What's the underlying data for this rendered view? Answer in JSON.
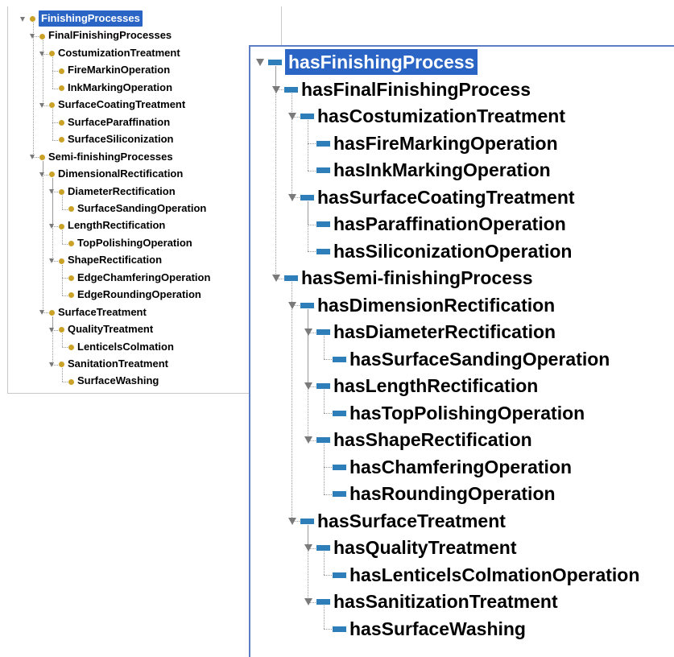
{
  "class_tree": {
    "items": [
      {
        "label": "FinishingProcesses",
        "depth": 0,
        "expanded": true,
        "selected": true
      },
      {
        "label": "FinalFinishingProcesses",
        "depth": 1,
        "expanded": true
      },
      {
        "label": "CostumizationTreatment",
        "depth": 2,
        "expanded": true
      },
      {
        "label": "FireMarkinOperation",
        "depth": 3
      },
      {
        "label": "InkMarkingOperation",
        "depth": 3
      },
      {
        "label": "SurfaceCoatingTreatment",
        "depth": 2,
        "expanded": true
      },
      {
        "label": "SurfaceParaffination",
        "depth": 3
      },
      {
        "label": "SurfaceSiliconization",
        "depth": 3
      },
      {
        "label": "Semi-finishingProcesses",
        "depth": 1,
        "expanded": true
      },
      {
        "label": "DimensionalRectification",
        "depth": 2,
        "expanded": true
      },
      {
        "label": "DiameterRectification",
        "depth": 3,
        "expanded": true
      },
      {
        "label": "SurfaceSandingOperation",
        "depth": 4
      },
      {
        "label": "LengthRectification",
        "depth": 3,
        "expanded": true
      },
      {
        "label": "TopPolishingOperation",
        "depth": 4
      },
      {
        "label": "ShapeRectification",
        "depth": 3,
        "expanded": true
      },
      {
        "label": "EdgeChamferingOperation",
        "depth": 4
      },
      {
        "label": "EdgeRoundingOperation",
        "depth": 4
      },
      {
        "label": "SurfaceTreatment",
        "depth": 2,
        "expanded": true
      },
      {
        "label": "QualityTreatment",
        "depth": 3,
        "expanded": true
      },
      {
        "label": "LenticelsColmation",
        "depth": 4
      },
      {
        "label": "SanitationTreatment",
        "depth": 3,
        "expanded": true
      },
      {
        "label": "SurfaceWashing",
        "depth": 4
      }
    ]
  },
  "property_tree": {
    "items": [
      {
        "label": "hasFinishingProcess",
        "depth": 0,
        "expanded": true,
        "selected": true
      },
      {
        "label": "hasFinalFinishingProcess",
        "depth": 1,
        "expanded": true
      },
      {
        "label": "hasCostumizationTreatment",
        "depth": 2,
        "expanded": true
      },
      {
        "label": "hasFireMarkingOperation",
        "depth": 3
      },
      {
        "label": "hasInkMarkingOperation",
        "depth": 3
      },
      {
        "label": "hasSurfaceCoatingTreatment",
        "depth": 2,
        "expanded": true
      },
      {
        "label": "hasParaffinationOperation",
        "depth": 3
      },
      {
        "label": "hasSiliconizationOperation",
        "depth": 3
      },
      {
        "label": "hasSemi-finishingProcess",
        "depth": 1,
        "expanded": true
      },
      {
        "label": "hasDimensionRectification",
        "depth": 2,
        "expanded": true
      },
      {
        "label": "hasDiameterRectification",
        "depth": 3,
        "expanded": true
      },
      {
        "label": "hasSurfaceSandingOperation",
        "depth": 4
      },
      {
        "label": "hasLengthRectification",
        "depth": 3,
        "expanded": true
      },
      {
        "label": "hasTopPolishingOperation",
        "depth": 4
      },
      {
        "label": "hasShapeRectification",
        "depth": 3,
        "expanded": true
      },
      {
        "label": "hasChamferingOperation",
        "depth": 4
      },
      {
        "label": "hasRoundingOperation",
        "depth": 4
      },
      {
        "label": "hasSurfaceTreatment",
        "depth": 2,
        "expanded": true
      },
      {
        "label": "hasQualityTreatment",
        "depth": 3,
        "expanded": true
      },
      {
        "label": "hasLenticelsColmationOperation",
        "depth": 4
      },
      {
        "label": "hasSanitizationTreatment",
        "depth": 3,
        "expanded": true
      },
      {
        "label": "hasSurfaceWashing",
        "depth": 4
      }
    ]
  },
  "colors": {
    "selection": "#2a64c5",
    "class_icon": "#c9a227",
    "property_icon": "#2e7fb9",
    "expand_arrow": "#7a7a7a",
    "right_panel_border": "#5b7ec4"
  },
  "icons": {
    "class_node": "class-dot-icon",
    "property_node": "object-property-icon",
    "expand": "expand-arrow-icon"
  }
}
